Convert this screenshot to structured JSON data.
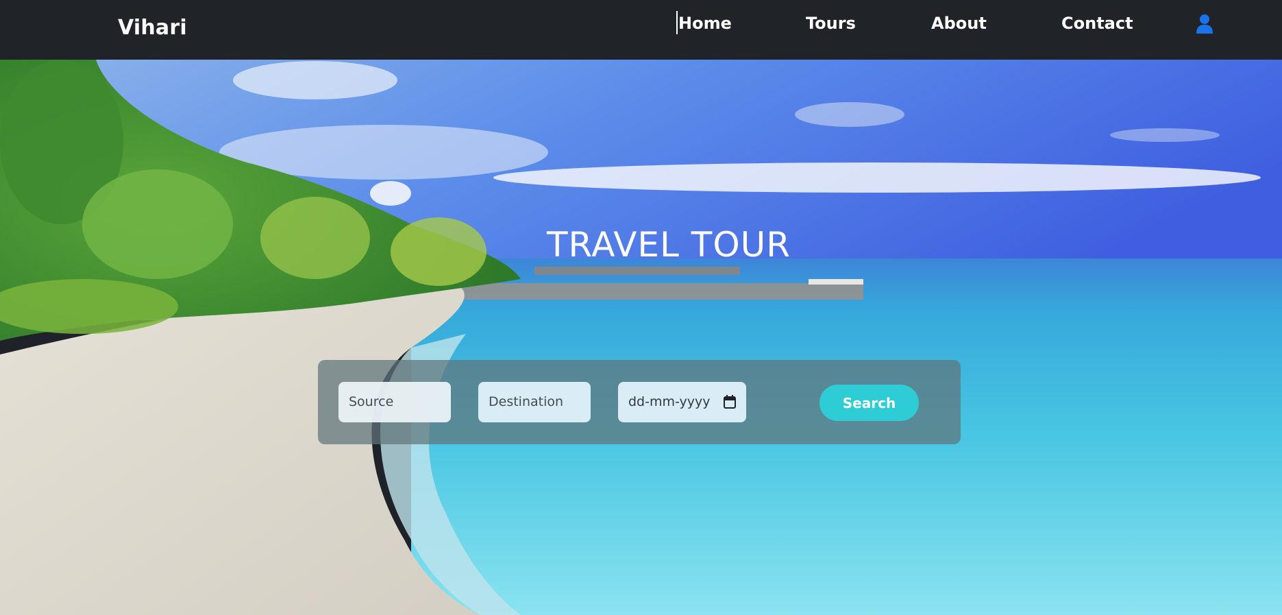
{
  "navbar": {
    "brand": "Vihari",
    "links": [
      {
        "label": "Home"
      },
      {
        "label": "Tours"
      },
      {
        "label": "About"
      },
      {
        "label": "Contact"
      }
    ],
    "user_icon": "user-icon",
    "user_icon_color": "#1a73e8"
  },
  "hero": {
    "title": "TRAVEL TOUR",
    "search": {
      "source_placeholder": "Source",
      "destination_placeholder": "Destination",
      "date_placeholder": "dd-mm-yyyy",
      "date_icon": "calendar-icon",
      "button_label": "Search",
      "button_color": "#2ecdd6"
    }
  }
}
